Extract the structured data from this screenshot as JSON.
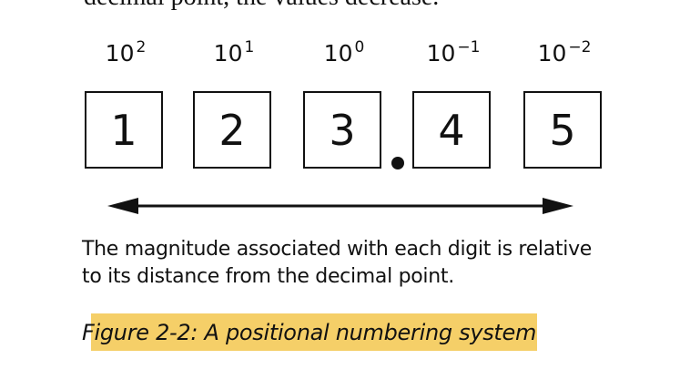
{
  "intro_text_fragment": "decimal point, the values decrease.",
  "powers": [
    {
      "base": "10",
      "exponent": "2"
    },
    {
      "base": "10",
      "exponent": "1"
    },
    {
      "base": "10",
      "exponent": "0"
    },
    {
      "base": "10",
      "exponent": "−1"
    },
    {
      "base": "10",
      "exponent": "−2"
    }
  ],
  "digits": [
    "1",
    "2",
    "3",
    "4",
    "5"
  ],
  "caption": {
    "line1": "The magnitude associated with each digit is relative",
    "line2": "to its distance from the decimal point."
  },
  "figure_label": "Figure 2-2: A positional numbering system",
  "colors": {
    "highlight": "#f5cf68",
    "ink": "#111111"
  }
}
